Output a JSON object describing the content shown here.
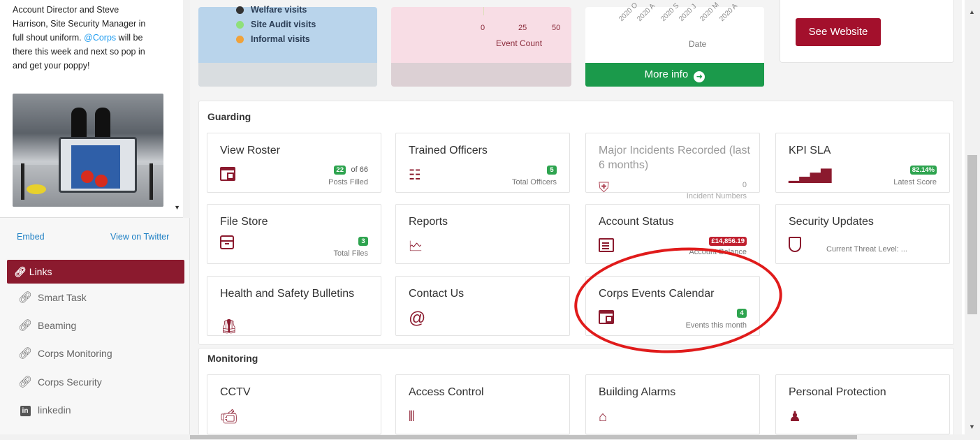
{
  "tweet": {
    "line1": "Account Director and Steve",
    "line2": "Harrison, Site Security Manager in",
    "line3_pre": "full shout uniform. ",
    "mention": "@Corps",
    "line3_post": " will be",
    "line4": "there this week and next so pop in",
    "line5": "and get your poppy!",
    "embed_label": "Embed",
    "view_twitter_label": "View on Twitter"
  },
  "links": {
    "header": "Links",
    "items": [
      {
        "label": "Smart Task",
        "icon": "link-icon"
      },
      {
        "label": "Beaming",
        "icon": "link-icon"
      },
      {
        "label": "Corps Monitoring",
        "icon": "link-icon"
      },
      {
        "label": "Corps Security",
        "icon": "link-icon"
      },
      {
        "label": "linkedin",
        "icon": "linkedin-icon"
      }
    ]
  },
  "visits_legend": [
    {
      "label": "Welfare visits",
      "color": "#333333"
    },
    {
      "label": "Site Audit visits",
      "color": "#8fe07a"
    },
    {
      "label": "Informal visits",
      "color": "#f0a23a"
    }
  ],
  "event_chart": {
    "ticks": [
      "0",
      "25",
      "50"
    ],
    "xlabel": "Event Count"
  },
  "date_chart": {
    "ticks": [
      "2020 O",
      "2020 A",
      "2020 S",
      "2020 J",
      "2020 M",
      "2020 A"
    ],
    "xlabel": "Date",
    "more_info_label": "More info"
  },
  "website_button": "See Website",
  "guarding": {
    "title": "Guarding",
    "tiles": [
      {
        "title": "View Roster",
        "badge": "22",
        "of": "of 66",
        "sub": "Posts Filled"
      },
      {
        "title": "Trained Officers",
        "badge": "5",
        "sub": "Total Officers"
      },
      {
        "title": "Major Incidents Recorded (last 6 months)",
        "value": "0",
        "sub": "Incident Numbers"
      },
      {
        "title": "KPI SLA",
        "badge": "82.14%",
        "sub": "Latest Score"
      },
      {
        "title": "File Store",
        "badge": "3",
        "sub": "Total Files"
      },
      {
        "title": "Reports"
      },
      {
        "title": "Account Status",
        "badge": "£14,856.19",
        "sub": "Account Balance"
      },
      {
        "title": "Security Updates",
        "sub": "Current Threat Level: ..."
      },
      {
        "title": "Health and Safety Bulletins"
      },
      {
        "title": "Contact Us"
      },
      {
        "title": "Corps Events Calendar",
        "badge": "4",
        "sub": "Events this month"
      }
    ]
  },
  "monitoring": {
    "title": "Monitoring",
    "tiles": [
      {
        "title": "CCTV"
      },
      {
        "title": "Access Control"
      },
      {
        "title": "Building Alarms"
      },
      {
        "title": "Personal Protection"
      }
    ]
  }
}
